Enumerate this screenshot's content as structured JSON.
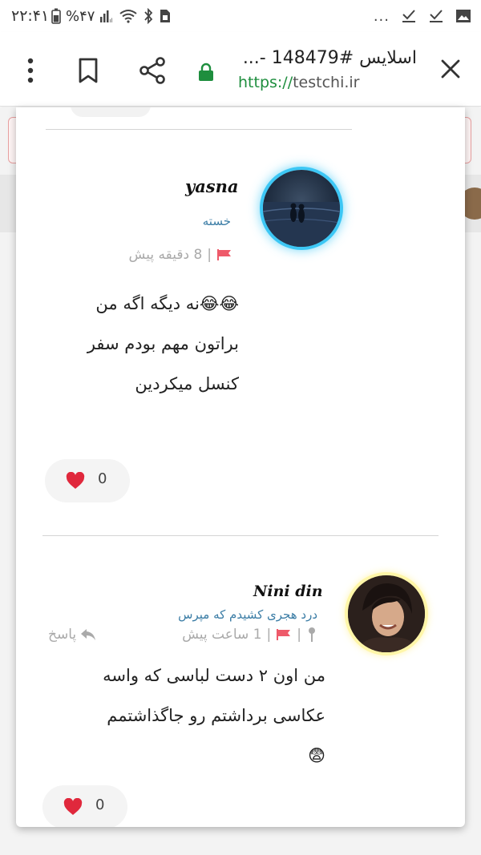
{
  "statusbar": {
    "time": "۲۲:۴۱",
    "battery_pct": "%۴۷",
    "more": "..."
  },
  "toolbar": {
    "title": "اسلایس #148479 -...",
    "url_scheme": "https://",
    "url_host": "testchi.ir"
  },
  "comments": [
    {
      "username": "yasna",
      "status": "خسته",
      "time": "8 دقیقه پیش",
      "lines": [
        "😂😂نه دیگه اگه من",
        "براتون مهم بودم سفر",
        "کنسل میکردین"
      ],
      "likes": "0"
    },
    {
      "username": "Nini din",
      "status": "درد هجری کشیدم که مپرس",
      "time": "1 ساعت پیش",
      "reply_label": "پاسخ",
      "lines": [
        "من اون ۲ دست لباسی که واسه",
        "عکاسی برداشتم رو جاگذاشتمم",
        "😨"
      ],
      "likes": "0"
    }
  ],
  "colors": {
    "link": "#3a7ca5",
    "url_green": "#1e8e3e",
    "avatar_ring_1": "#3cc7f5",
    "avatar_ring_2": "#fff6a8",
    "flag": "#ee5a6a",
    "heart": "#e0283c"
  }
}
